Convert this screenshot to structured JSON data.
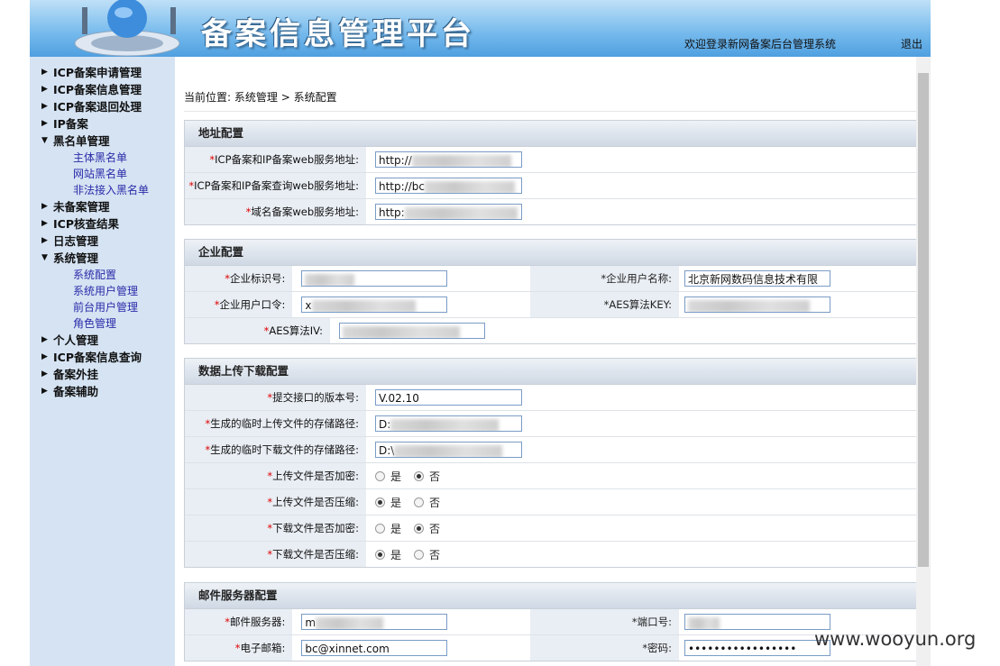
{
  "header": {
    "title": "备案信息管理平台",
    "welcome": "欢迎登录新网备案后台管理系统",
    "logout": "退出",
    "logo_icon": "globe-logo-icon"
  },
  "sidebar": {
    "items": [
      {
        "label": "ICP备案申请管理",
        "expanded": false
      },
      {
        "label": "ICP备案信息管理",
        "expanded": false
      },
      {
        "label": "ICP备案退回处理",
        "expanded": false
      },
      {
        "label": "IP备案",
        "expanded": false
      },
      {
        "label": "黑名单管理",
        "expanded": true,
        "children": [
          "主体黑名单",
          "网站黑名单",
          "非法接入黑名单"
        ]
      },
      {
        "label": "未备案管理",
        "expanded": false
      },
      {
        "label": "ICP核查结果",
        "expanded": false
      },
      {
        "label": "日志管理",
        "expanded": false
      },
      {
        "label": "系统管理",
        "expanded": true,
        "children": [
          "系统配置",
          "系统用户管理",
          "前台用户管理",
          "角色管理"
        ]
      },
      {
        "label": "个人管理",
        "expanded": false
      },
      {
        "label": "ICP备案信息查询",
        "expanded": false
      },
      {
        "label": "备案外挂",
        "expanded": false
      },
      {
        "label": "备案辅助",
        "expanded": false
      }
    ]
  },
  "breadcrumb": {
    "prefix": "当前位置:",
    "path1": "系统管理",
    "sep": ">",
    "path2": "系统配置"
  },
  "address_config": {
    "title": "地址配置",
    "fields": [
      {
        "label": "ICP备案和IP备案web服务地址:",
        "value": "http://"
      },
      {
        "label": "ICP备案和IP备案查询web服务地址:",
        "value": "http://bc"
      },
      {
        "label": "域名备案web服务地址:",
        "value": "http:"
      }
    ]
  },
  "enterprise_config": {
    "title": "企业配置",
    "id_label": "企业标识号:",
    "id_value": "",
    "username_label": "企业用户名称:",
    "username_value": "北京新网数码信息技术有限",
    "password_label": "企业用户口令:",
    "password_value": "x",
    "aeskey_label": "AES算法KEY:",
    "aeskey_value": "",
    "aesiv_label": "AES算法IV:",
    "aesiv_value": ""
  },
  "data_config": {
    "title": "数据上传下载配置",
    "version_label": "提交接口的版本号:",
    "version_value": "V.02.10",
    "upload_path_label": "生成的临时上传文件的存储路径:",
    "upload_path_value": "D:",
    "download_path_label": "生成的临时下载文件的存储路径:",
    "download_path_value": "D:\\",
    "yes": "是",
    "no": "否",
    "radios": [
      {
        "label": "上传文件是否加密:",
        "selected": "no"
      },
      {
        "label": "上传文件是否压缩:",
        "selected": "yes"
      },
      {
        "label": "下载文件是否加密:",
        "selected": "no"
      },
      {
        "label": "下载文件是否压缩:",
        "selected": "yes"
      }
    ]
  },
  "mail_config": {
    "title": "邮件服务器配置",
    "server_label": "邮件服务器:",
    "server_value": "m",
    "port_label": "端口号:",
    "port_value": "",
    "email_label": "电子邮箱:",
    "email_value": "bc@xinnet.com",
    "pwd_label": "密码:",
    "pwd_value": "•••••••••••••••••"
  },
  "watermark": "www.wooyun.org",
  "colors": {
    "header_blue": "#4f9fe0",
    "sidebar_bg": "#d5e3f3",
    "required_star": "#d00000",
    "link": "#2b2ba8"
  }
}
